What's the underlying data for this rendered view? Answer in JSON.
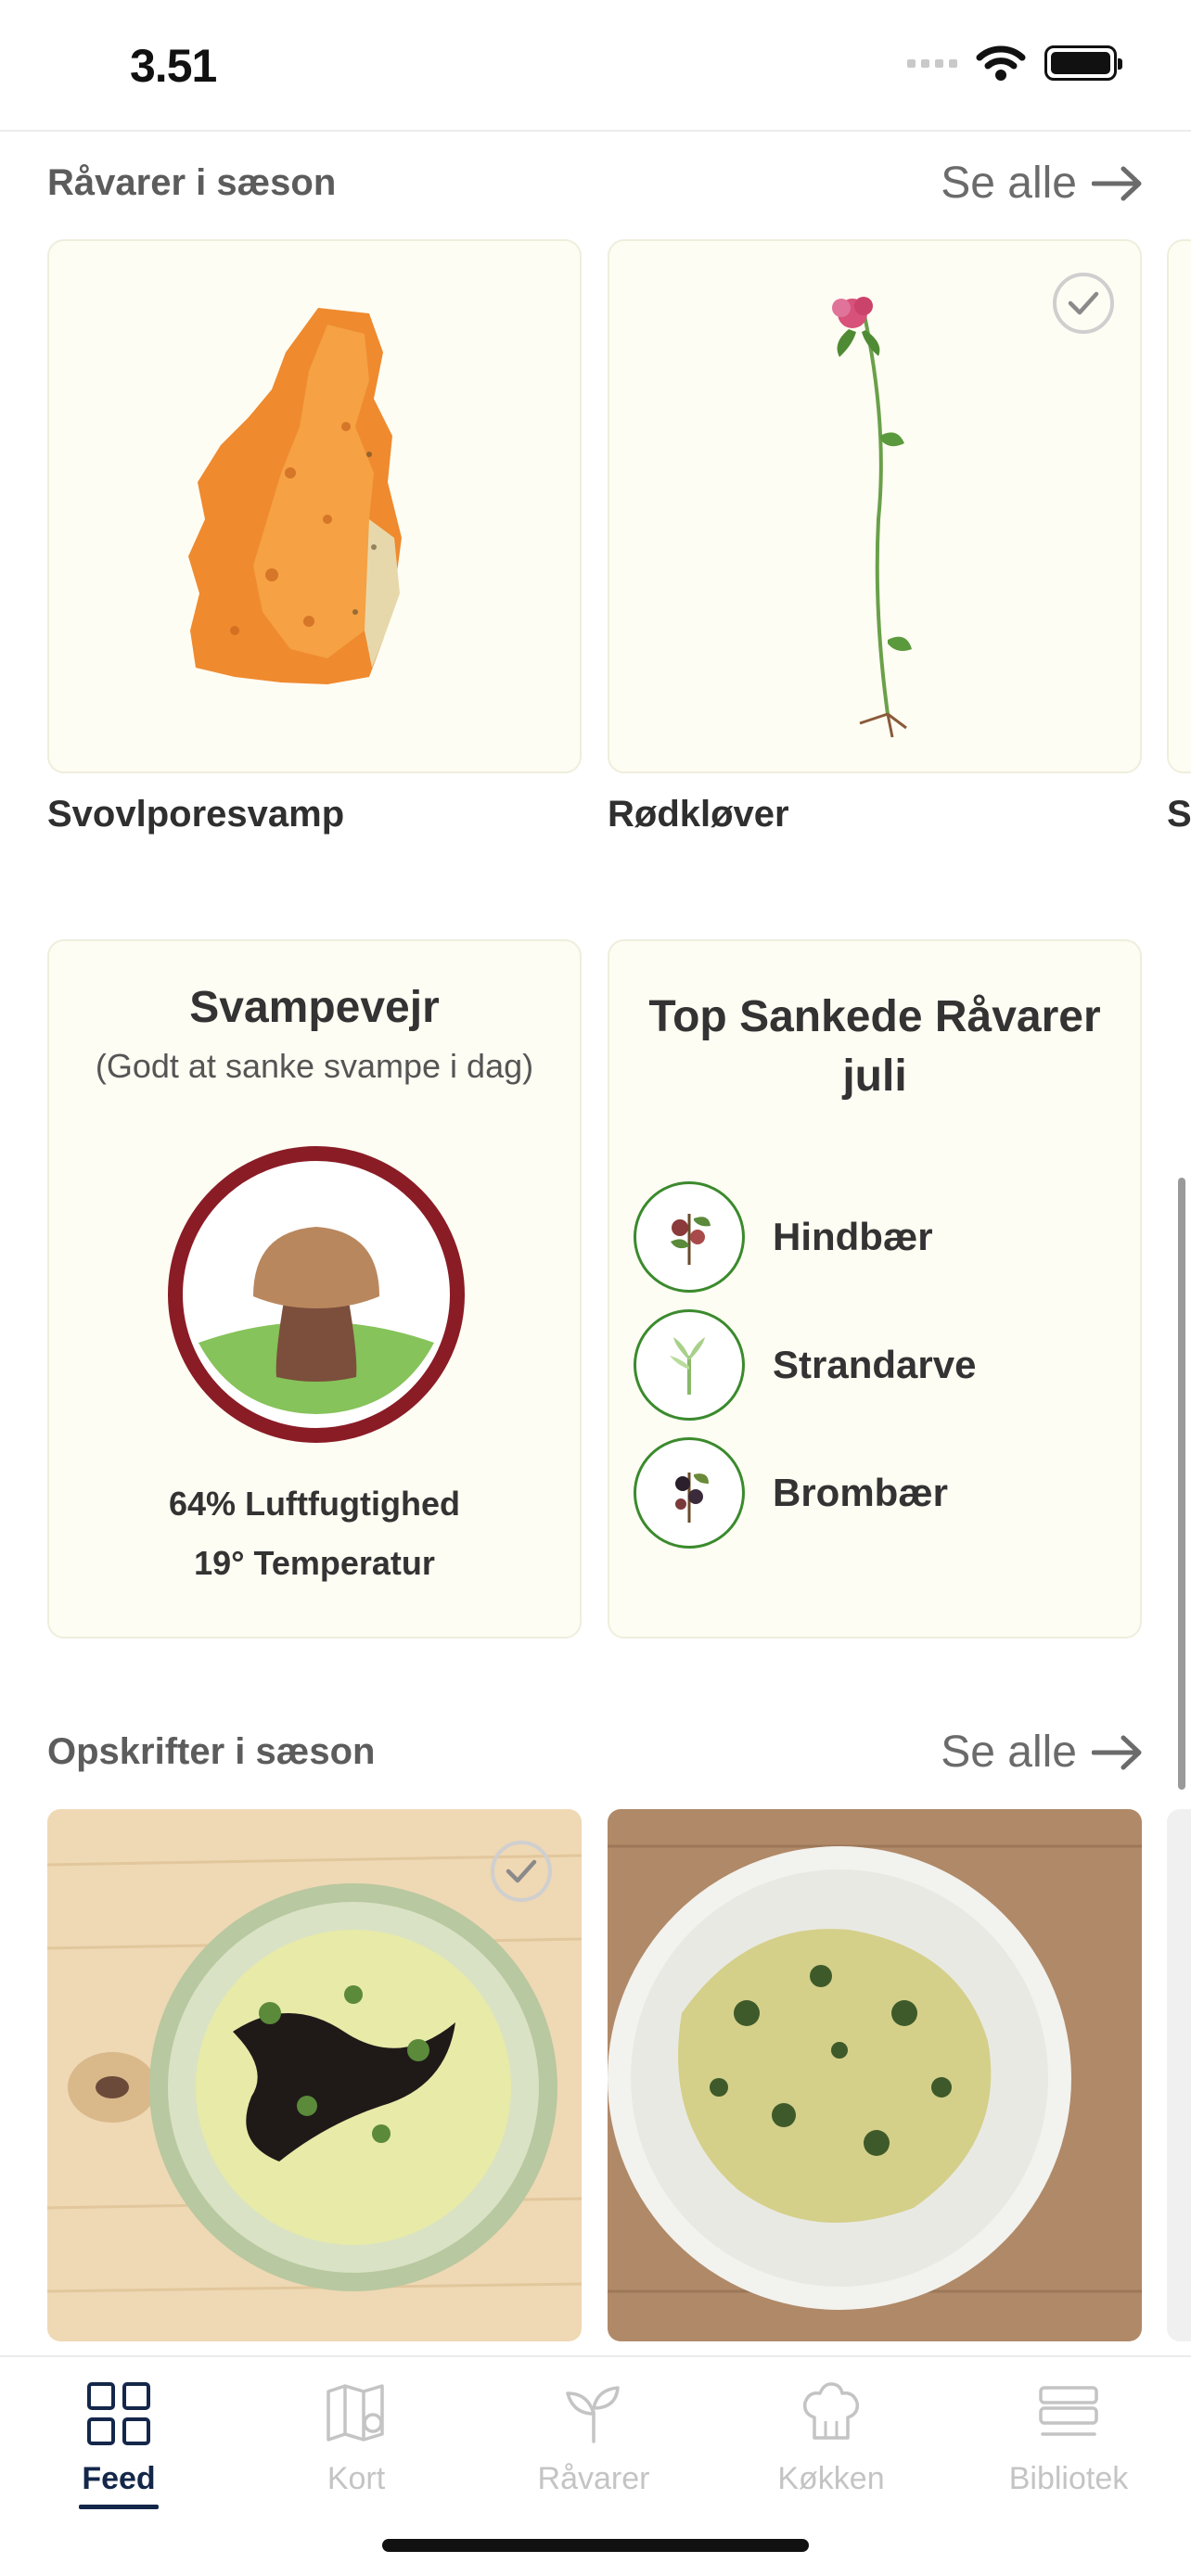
{
  "status_bar": {
    "time": "3.51"
  },
  "seasonal_produce": {
    "title": "Råvarer i sæson",
    "see_all": "Se alle",
    "items": [
      {
        "label": "Svovlporesvamp",
        "checked": false
      },
      {
        "label": "Rødkløver",
        "checked": true
      },
      {
        "label": "S",
        "checked": false
      }
    ]
  },
  "mushroom_weather": {
    "title": "Svampevejr",
    "subtitle": "(Godt at sanke svampe i dag)",
    "humidity": "64% Luftfugtighed",
    "temperature": "19° Temperatur"
  },
  "top_foraged": {
    "title": "Top Sankede Råvarer juli",
    "items": [
      {
        "name": "Hindbær"
      },
      {
        "name": "Strandarve"
      },
      {
        "name": "Brombær"
      }
    ]
  },
  "seasonal_recipes": {
    "title": "Opskrifter i sæson",
    "see_all": "Se alle",
    "items": [
      {
        "checked": true
      },
      {
        "checked": false
      }
    ]
  },
  "tab_bar": {
    "tabs": [
      {
        "label": "Feed",
        "active": true
      },
      {
        "label": "Kort",
        "active": false
      },
      {
        "label": "Råvarer",
        "active": false
      },
      {
        "label": "Køkken",
        "active": false
      },
      {
        "label": "Bibliotek",
        "active": false
      }
    ]
  },
  "colors": {
    "accent": "#14274a",
    "card_background": "#fefdf3",
    "weather_ring": "#8a1c26",
    "mushroom_ground": "#86c35a",
    "list_ring": "#3b8a2d"
  }
}
